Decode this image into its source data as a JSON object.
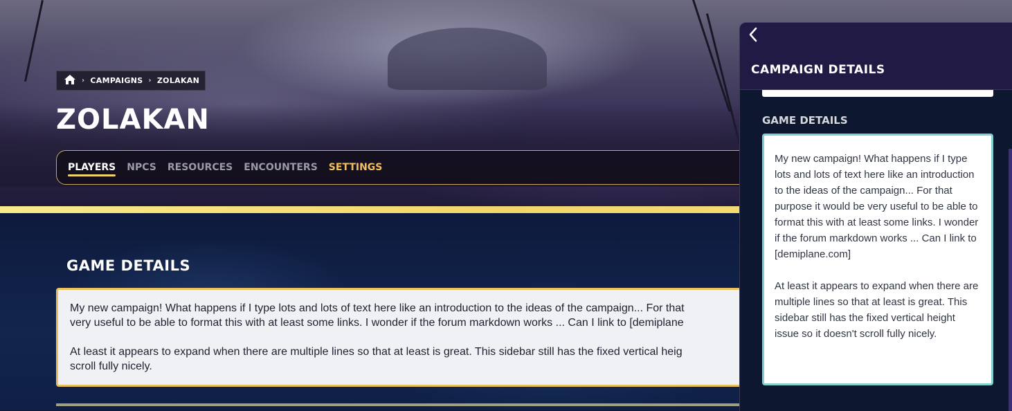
{
  "breadcrumb": {
    "home_icon": "home-icon",
    "items": [
      "CAMPAIGNS",
      "ZOLAKAN"
    ]
  },
  "page": {
    "title": "ZOLAKAN"
  },
  "tabs": [
    {
      "label": "PLAYERS",
      "active": true
    },
    {
      "label": "NPCS"
    },
    {
      "label": "RESOURCES"
    },
    {
      "label": "ENCOUNTERS"
    },
    {
      "label": "SETTINGS"
    }
  ],
  "main": {
    "heading": "GAME DETAILS",
    "lines": [
      "My new campaign! What happens if I type lots and lots of text here like an introduction to the ideas of the campaign... For that",
      "very useful to be able to format this with at least some links. I wonder if the forum markdown works ... Can I link to [demiplane"
    ],
    "lines2": [
      "At least it appears to expand when there are multiple lines so that at least is great. This sidebar still has the fixed vertical heig",
      "scroll fully nicely."
    ]
  },
  "sidebar": {
    "back_icon": "chevron-left-icon",
    "title": "CAMPAIGN DETAILS",
    "section_heading": "GAME DETAILS",
    "paragraph1": "My new campaign! What happens if I type lots and lots of text here like an introduction to the ideas of the campaign... For that purpose it would be very useful to be able to format this with at least some links. I wonder if the forum markdown works ... Can I link to [demiplane.com]",
    "paragraph2": "At least it appears to expand when there are multiple lines so that at least is great. This sidebar still has the fixed vertical height issue so it doesn't scroll fully nicely."
  },
  "colors": {
    "accent_gold": "#f2d36b",
    "settings_tab": "#f2c060",
    "sidebar_border": "#7fd0cf",
    "sidebar_header": "#211a45"
  }
}
